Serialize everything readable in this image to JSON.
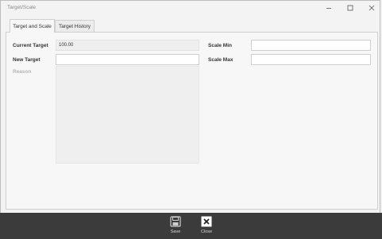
{
  "window": {
    "title": "Target/Scale"
  },
  "tabs": [
    {
      "label": "Target and Scale",
      "active": true
    },
    {
      "label": "Target History",
      "active": false
    }
  ],
  "form": {
    "current_target_label": "Current Target",
    "current_target_value": "100.00",
    "new_target_label": "New Target",
    "new_target_value": "",
    "reason_label": "Reason",
    "scale_min_label": "Scale Min",
    "scale_min_value": "",
    "scale_max_label": "Scale Max",
    "scale_max_value": ""
  },
  "footer": {
    "save_label": "Save",
    "close_label": "Close"
  },
  "colors": {
    "footer_bg": "#3b3b3b",
    "panel_bg": "#f7f7f7"
  }
}
